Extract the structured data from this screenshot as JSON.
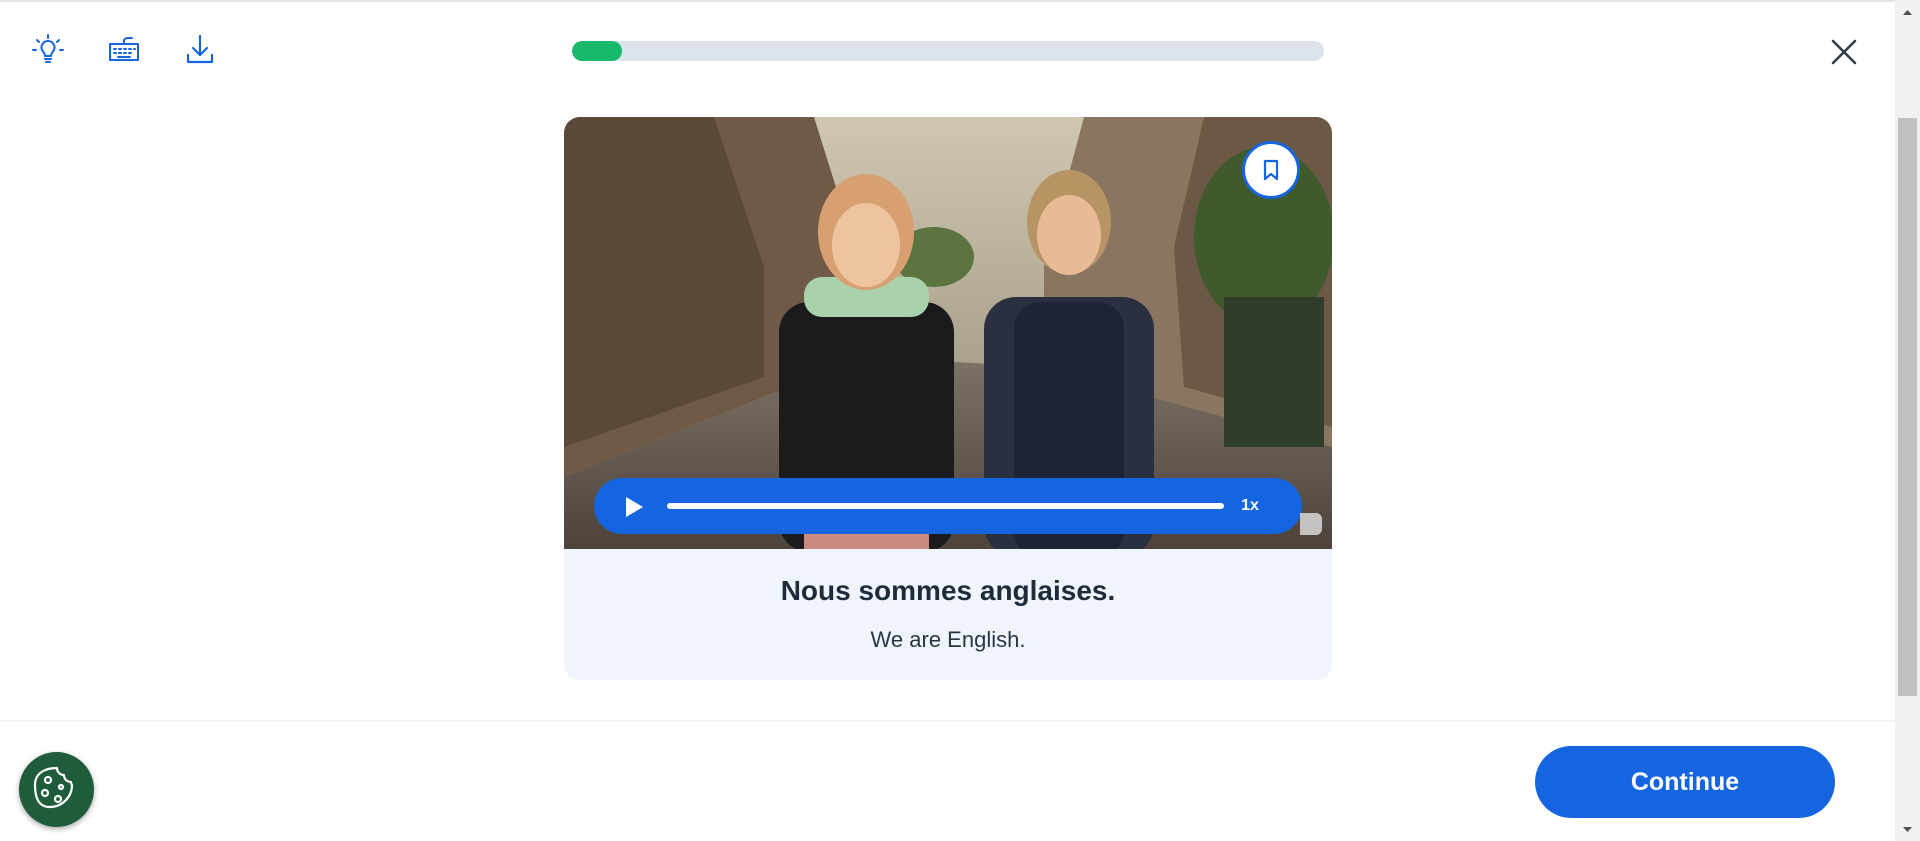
{
  "toolbar": {
    "items": [
      {
        "name": "hint",
        "icon": "lightbulb-icon"
      },
      {
        "name": "keyboard",
        "icon": "keyboard-icon"
      },
      {
        "name": "download",
        "icon": "download-icon"
      }
    ]
  },
  "lesson_progress": {
    "fraction": 0.066
  },
  "close": {
    "icon": "close-icon"
  },
  "video": {
    "bookmark_icon": "bookmark-icon",
    "play_icon": "play-icon",
    "playback_progress": 0,
    "speed_label": "1x"
  },
  "phrase": {
    "text": "Nous sommes anglaises.",
    "translation": "We are English."
  },
  "footer": {
    "cookie_icon": "cookie-icon",
    "continue_label": "Continue"
  },
  "colors": {
    "accent": "#1565e0",
    "progress": "#18b86c",
    "card_bg": "#f0f5fd",
    "cookie_bg": "#1f5c3c"
  }
}
